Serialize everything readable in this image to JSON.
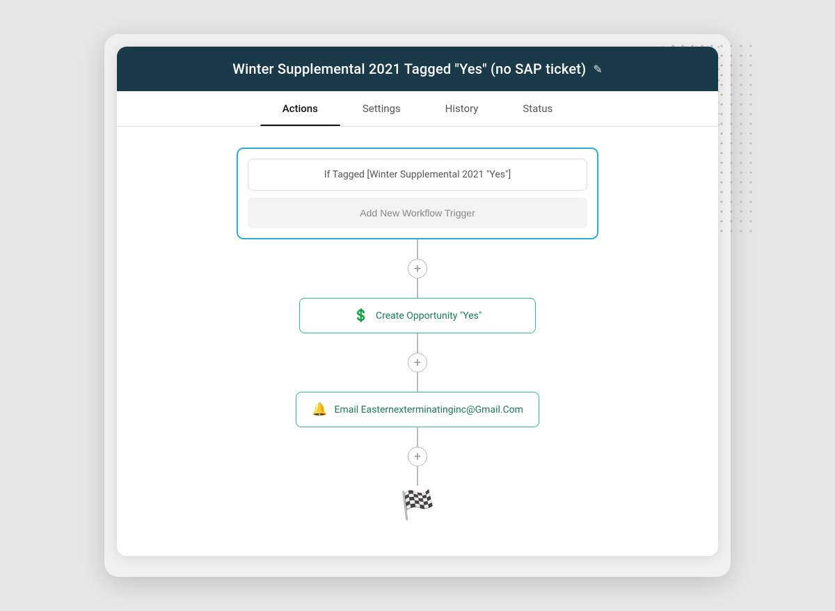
{
  "header": {
    "title": "Winter Supplemental 2021 Tagged \"Yes\" (no SAP ticket)",
    "edit_icon": "✎"
  },
  "tabs": [
    {
      "id": "actions",
      "label": "Actions",
      "active": true
    },
    {
      "id": "settings",
      "label": "Settings",
      "active": false
    },
    {
      "id": "history",
      "label": "History",
      "active": false
    },
    {
      "id": "status",
      "label": "Status",
      "active": false
    }
  ],
  "workflow": {
    "trigger_condition": "If Tagged [Winter Supplemental 2021 \"Yes\"]",
    "add_trigger_label": "Add New Workflow Trigger",
    "actions": [
      {
        "id": "create-opportunity",
        "icon": "💲",
        "label": "Create Opportunity \"Yes\""
      },
      {
        "id": "email-action",
        "icon": "🔔",
        "label": "Email Easternexterminatinginc@Gmail.Com"
      }
    ],
    "add_step_symbol": "+",
    "finish_icon": "🏁"
  }
}
